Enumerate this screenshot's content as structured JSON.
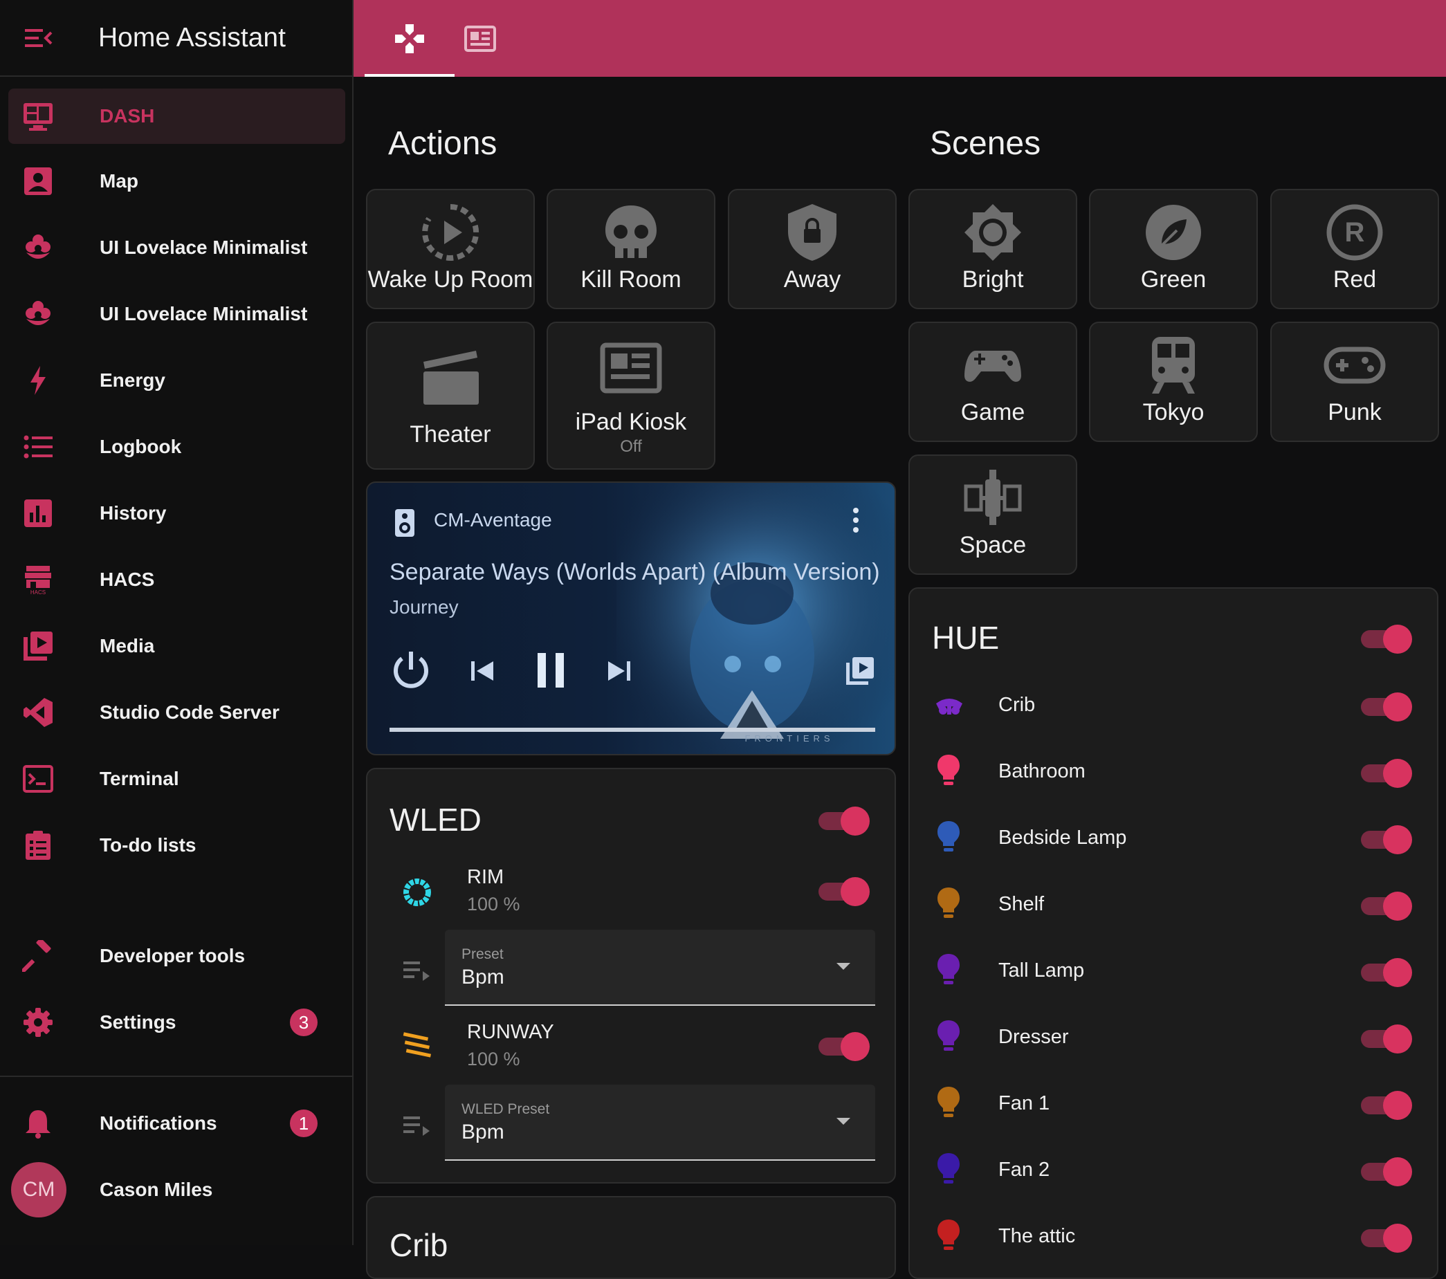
{
  "app": {
    "title": "Home Assistant"
  },
  "sidebar": {
    "items": [
      {
        "label": "DASH",
        "icon": "monitor-dashboard-icon",
        "active": true
      },
      {
        "label": "Map",
        "icon": "account-box-icon"
      },
      {
        "label": "UI Lovelace Minimalist",
        "icon": "flower-icon"
      },
      {
        "label": "UI Lovelace Minimalist",
        "icon": "flower-icon"
      },
      {
        "label": "Energy",
        "icon": "lightning-bolt-icon"
      },
      {
        "label": "Logbook",
        "icon": "format-list-bulleted-icon"
      },
      {
        "label": "History",
        "icon": "chart-box-icon"
      },
      {
        "label": "HACS",
        "icon": "hacs-store-icon"
      },
      {
        "label": "Media",
        "icon": "play-box-multiple-icon"
      },
      {
        "label": "Studio Code Server",
        "icon": "vscode-icon"
      },
      {
        "label": "Terminal",
        "icon": "console-icon"
      },
      {
        "label": "To-do lists",
        "icon": "clipboard-list-icon"
      }
    ],
    "developer_tools": "Developer tools",
    "settings": {
      "label": "Settings",
      "badge": "3"
    },
    "notifications": {
      "label": "Notifications",
      "badge": "1"
    },
    "user": {
      "initials": "CM",
      "name": "Cason Miles"
    }
  },
  "tabs": [
    {
      "icon": "gamepad-variant-icon",
      "active": true
    },
    {
      "icon": "newspaper-icon",
      "active": false
    }
  ],
  "actions": {
    "title": "Actions",
    "buttons": [
      {
        "label": "Wake Up Room",
        "icon": "restart-play-icon"
      },
      {
        "label": "Kill Room",
        "icon": "skull-icon"
      },
      {
        "label": "Away",
        "icon": "shield-lock-icon"
      },
      {
        "label": "Theater",
        "icon": "movie-clapper-icon"
      },
      {
        "label": "iPad Kiosk",
        "icon": "newspaper-icon",
        "state": "Off"
      }
    ]
  },
  "scenes": {
    "title": "Scenes",
    "buttons": [
      {
        "label": "Bright",
        "icon": "brightness-icon"
      },
      {
        "label": "Green",
        "icon": "leaf-circle-icon"
      },
      {
        "label": "Red",
        "icon": "registered-icon"
      },
      {
        "label": "Game",
        "icon": "gamepad-icon"
      },
      {
        "label": "Tokyo",
        "icon": "train-icon"
      },
      {
        "label": "Punk",
        "icon": "controller-icon"
      },
      {
        "label": "Space",
        "icon": "satellite-icon"
      }
    ]
  },
  "media_player": {
    "device": "CM-Aventage",
    "track": "Separate Ways (Worlds Apart) (Album Version)",
    "artist": "Journey",
    "album_text": "FRONTIERS",
    "progress": 1.0
  },
  "wled": {
    "title": "WLED",
    "rows": [
      {
        "name": "RIM",
        "value": "100 %",
        "icon": "ring-light-icon",
        "color": "#2fd6e6"
      },
      {
        "name": "RUNWAY",
        "value": "100 %",
        "icon": "led-strip-icon",
        "color": "#f0a020"
      }
    ],
    "selects": [
      {
        "label": "Preset",
        "value": "Bpm"
      },
      {
        "label": "WLED Preset",
        "value": "Bpm"
      }
    ]
  },
  "crib_card": {
    "title": "Crib"
  },
  "hue": {
    "title": "HUE",
    "lights": [
      {
        "name": "Crib",
        "color": "#7b2ac9"
      },
      {
        "name": "Bathroom",
        "color": "#f0386b"
      },
      {
        "name": "Bedside Lamp",
        "color": "#2e5bb8"
      },
      {
        "name": "Shelf",
        "color": "#b06a14"
      },
      {
        "name": "Tall Lamp",
        "color": "#6a1fb0"
      },
      {
        "name": "Dresser",
        "color": "#6a1fb0"
      },
      {
        "name": "Fan 1",
        "color": "#b06a14"
      },
      {
        "name": "Fan 2",
        "color": "#3a1aa8"
      },
      {
        "name": "The attic",
        "color": "#c42020"
      }
    ]
  },
  "colors": {
    "accent": "#b0325a",
    "toggle_on": "#d8335f",
    "background": "#0f0f10",
    "card": "#1c1c1c"
  }
}
